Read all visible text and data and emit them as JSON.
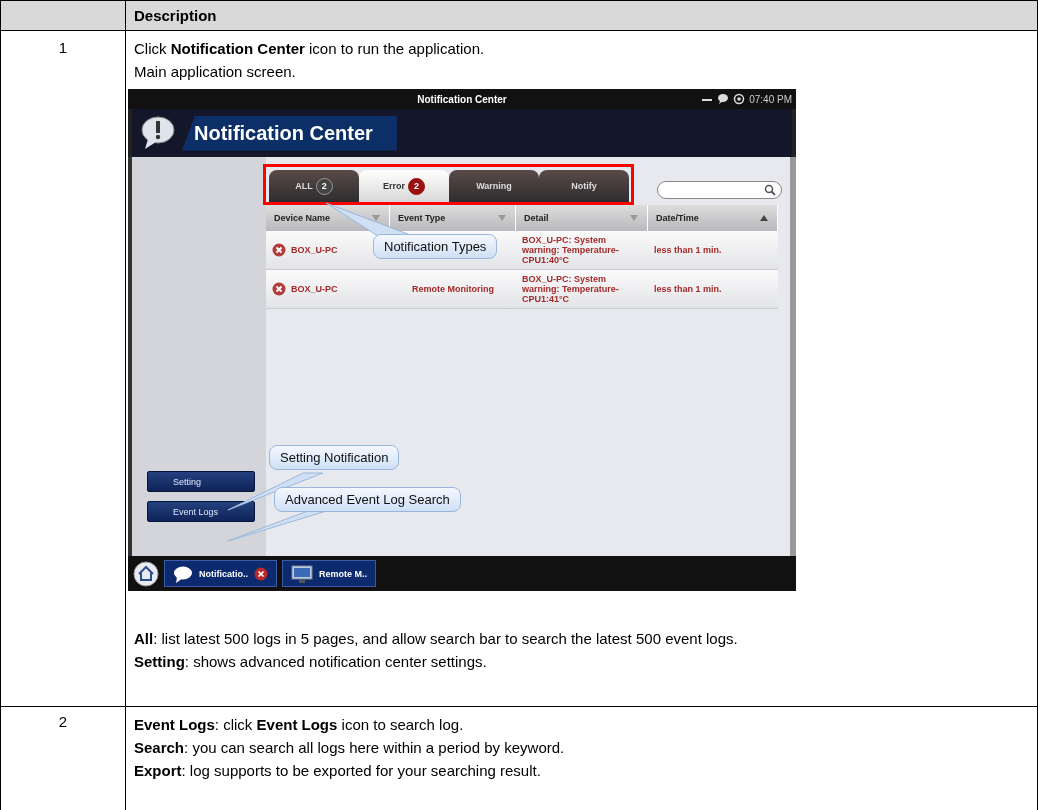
{
  "table": {
    "header": {
      "column_2": "Description"
    },
    "rows": [
      {
        "number": "1",
        "intro": [
          "Click **Notification Center** icon to run the application.",
          "Main application screen."
        ],
        "screenshot": {
          "title_bar": {
            "title": "Notification Center",
            "time": "07:40 PM"
          },
          "app_header": {
            "title": "Notification Center"
          },
          "tabs_highlighted": true,
          "tabs": [
            {
              "label": "ALL",
              "count": "2",
              "selected": false
            },
            {
              "label": "Error",
              "count": "2",
              "selected": true
            },
            {
              "label": "Warning",
              "selected": false
            },
            {
              "label": "Notify",
              "selected": false
            }
          ],
          "columns": [
            {
              "label": "Device Name",
              "sort_ascending": false
            },
            {
              "label": "Event Type",
              "sort_ascending": false
            },
            {
              "label": "Detail",
              "sort_ascending": false
            },
            {
              "label": "Date/Time",
              "sort_ascending": true
            }
          ],
          "rows": [
            {
              "device": "BOX_U-PC",
              "detail": "BOX_U-PC:  System warning: Temperature-CPU1:40°C",
              "time": "less than 1 min."
            },
            {
              "device": "BOX_U-PC",
              "event_type": "Remote Monitoring",
              "detail": "BOX_U-PC:  System warning: Temperature-CPU1:41°C",
              "time": "less than 1 min."
            }
          ],
          "side_buttons": [
            "Setting",
            "Event Logs"
          ],
          "taskbar": [
            {
              "label": "Notificatio..",
              "kind": "chat",
              "closable": true
            },
            {
              "label": "Remote M..",
              "kind": "monitor",
              "closable": false
            }
          ],
          "callouts": [
            "Notification Types",
            "Setting Notification",
            "Advanced Event Log Search"
          ]
        },
        "notes": [
          "**All**: list latest 500 logs in 5 pages, and allow search bar to search the latest 500 event logs.",
          "**Setting**: shows advanced notification center settings."
        ]
      },
      {
        "number": "2",
        "notes": [
          "**Event Logs**: click **Event Logs** icon to search log.",
          "**Search**: you can search all logs here within a period by keyword.",
          "**Export**: log supports to be exported for your searching result."
        ]
      }
    ]
  }
}
